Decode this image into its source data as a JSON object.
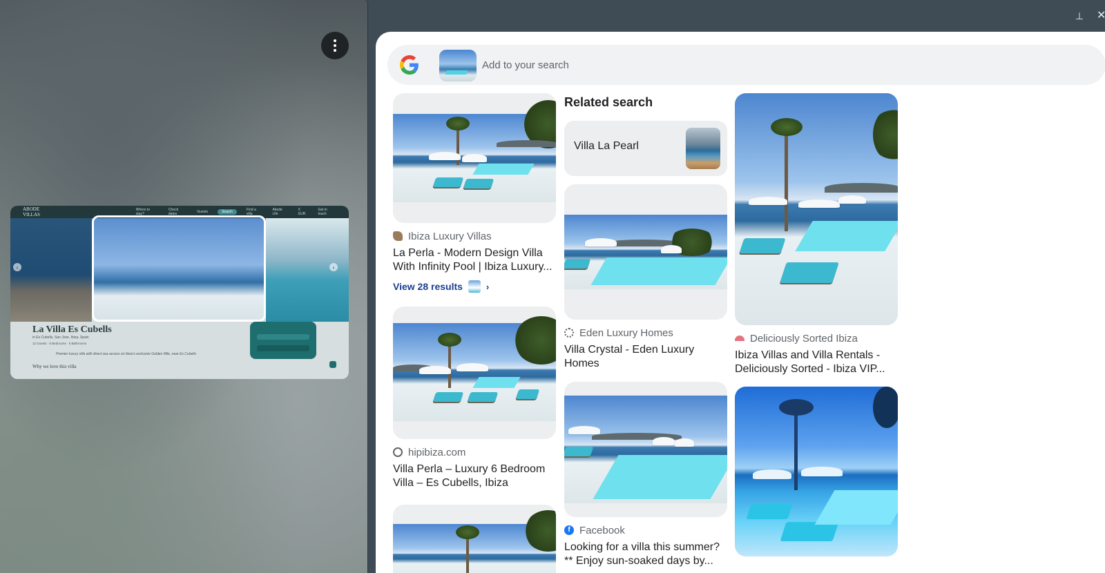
{
  "search": {
    "placeholder": "Add to your search"
  },
  "source_page": {
    "site_logo": "ABODE VILLAS",
    "nav_items": [
      "Where to stay?",
      "Check dates",
      "Guests",
      "Search",
      "Find a villa",
      "Abode Life",
      "€ EUR",
      "Get in touch"
    ],
    "villa_name": "La Villa Es Cubells",
    "location": "in Es Cubells, San Jose, Ibiza, Spain",
    "meta": "12 Guests · 6 Bedrooms · 6 Bathrooms",
    "description": "Premier luxury villa with direct sea access on Ibiza's exclusive Golden Mile, near Es Cubells",
    "why_heading": "Why we love this villa"
  },
  "results": {
    "column1": [
      {
        "source": "Ibiza Luxury Villas",
        "title": "La Perla - Modern Design Villa With Infinity Pool | Ibiza Luxury...",
        "view_results": "View 28 results"
      },
      {
        "source": "hipibiza.com",
        "title": "Villa Perla – Luxury 6 Bedroom Villa – Es Cubells, Ibiza"
      }
    ],
    "related": {
      "heading": "Related search",
      "chip_label": "Villa La Pearl"
    },
    "column2": [
      {
        "source": "Eden Luxury Homes",
        "title": "Villa Crystal - Eden Luxury Homes"
      },
      {
        "source": "Facebook",
        "title": "Looking for a villa this summer? ** Enjoy sun-soaked days by..."
      }
    ],
    "column3": [
      {
        "source": "Deliciously Sorted Ibiza",
        "title": "Ibiza Villas and Villa Rentals - Deliciously Sorted - Ibiza VIP..."
      }
    ]
  },
  "colors": {
    "panel_bg": "#ffffff",
    "search_bg": "#f0f2f4",
    "link_blue": "#1a3d8f",
    "frame_bg": "#3f4c55"
  },
  "icons": {
    "window_pin": "pin-icon",
    "window_close": "close-icon",
    "overflow": "more-vert-icon",
    "google": "google-logo-icon"
  }
}
